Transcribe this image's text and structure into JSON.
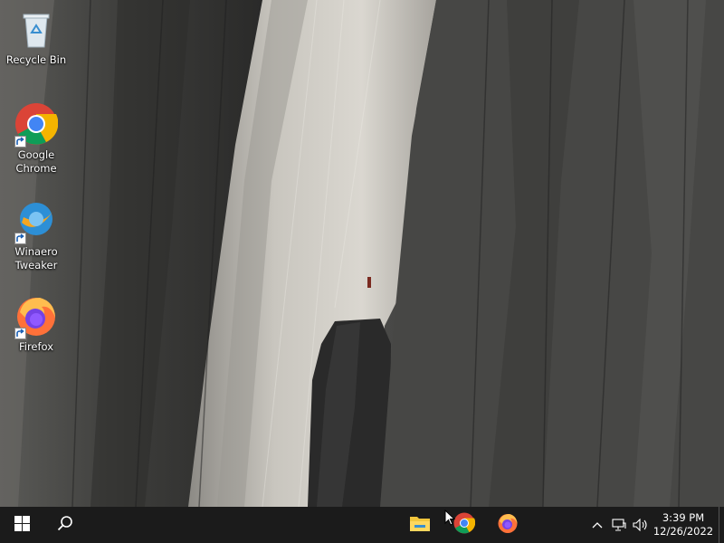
{
  "desktop": {
    "icons": [
      {
        "label": "Recycle Bin",
        "icon": "recycle-bin-icon"
      },
      {
        "label": "Google\nChrome",
        "icon": "chrome-icon"
      },
      {
        "label": "Winaero\nTweaker",
        "icon": "winaero-tweaker-icon"
      },
      {
        "label": "Firefox",
        "icon": "firefox-icon"
      }
    ]
  },
  "taskbar": {
    "start_icon": "windows-logo-icon",
    "search_icon": "search-icon",
    "pinned": [
      {
        "name": "File Explorer",
        "icon": "file-explorer-icon"
      },
      {
        "name": "Google Chrome",
        "icon": "chrome-icon"
      },
      {
        "name": "Firefox",
        "icon": "firefox-icon"
      }
    ],
    "tray": {
      "chevron_icon": "chevron-up-icon",
      "network_icon": "network-icon",
      "volume_icon": "volume-icon",
      "time": "3:39 PM",
      "date": "12/26/2022"
    },
    "colors": {
      "background": "#1b1b1b",
      "text": "#ffffff"
    }
  }
}
